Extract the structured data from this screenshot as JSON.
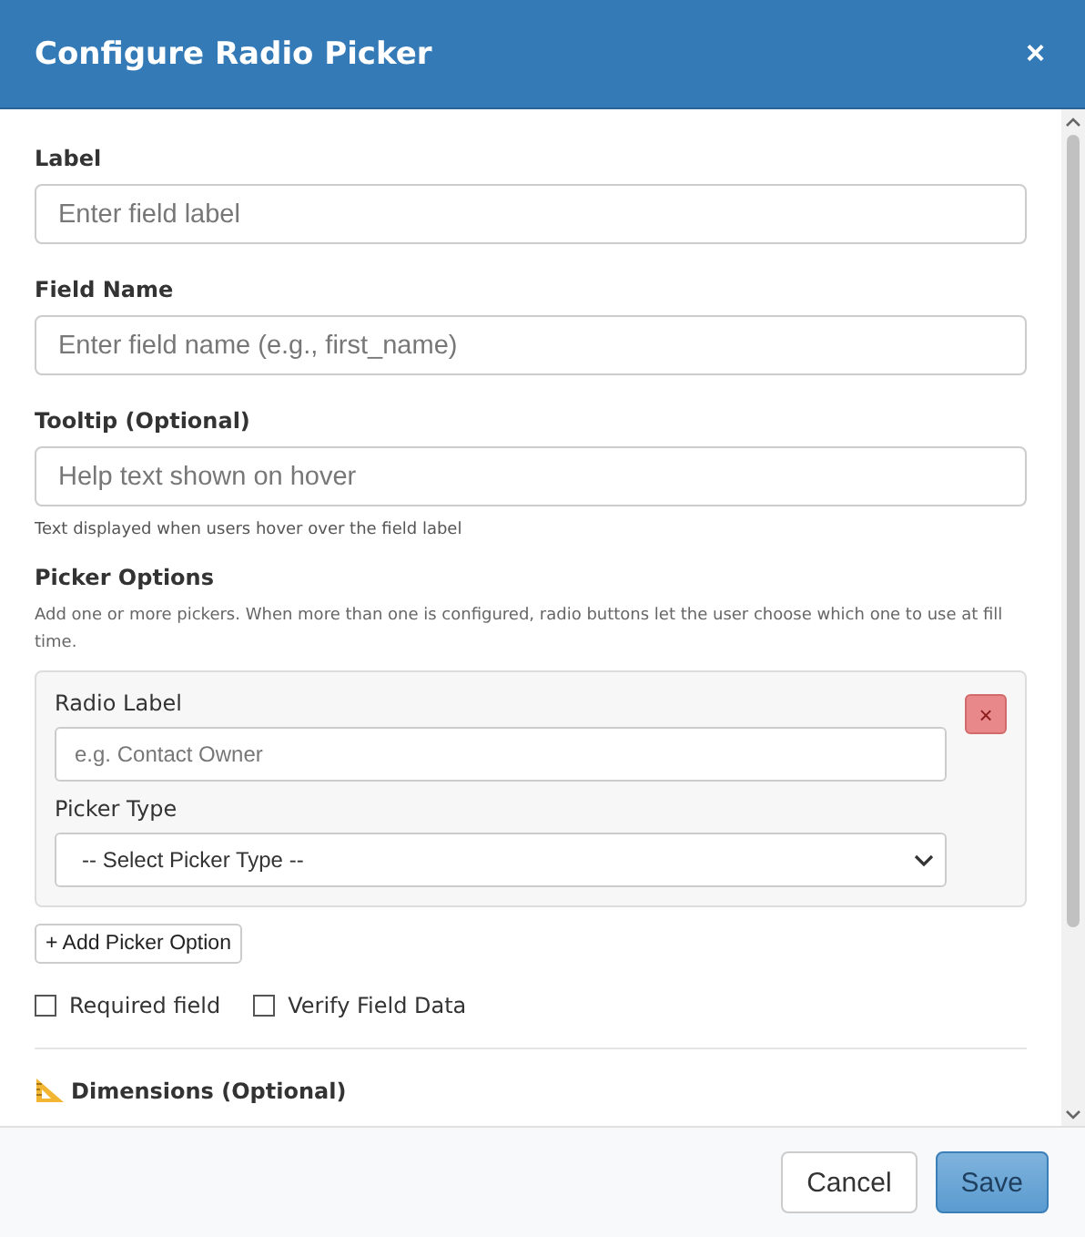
{
  "dialog": {
    "title": "Configure Radio Picker",
    "close": "×"
  },
  "fields": [
    {
      "label": "Label",
      "placeholder": "Enter field label"
    },
    {
      "label": "Field Name",
      "placeholder": "Enter field name (e.g., first_name)"
    },
    {
      "label": "Tooltip (Optional)",
      "placeholder": "Help text shown on hover",
      "help": "Text displayed when users hover over the field label"
    }
  ],
  "picker_options": {
    "heading": "Picker Options",
    "description": "Add one or more pickers. When more than one is configured, radio buttons let the user choose which one to use at fill time.",
    "options": [
      {
        "radio_label": "Radio Label",
        "radio_placeholder": "e.g. Contact Owner",
        "type_label": "Picker Type",
        "type_value": "-- Select Picker Type --",
        "remove": "×"
      }
    ],
    "add_button": "+ Add Picker Option"
  },
  "checkboxes": [
    {
      "label": "Required field",
      "checked": false
    },
    {
      "label": "Verify Field Data",
      "checked": false
    }
  ],
  "section": {
    "title": "Dimensions (Optional)"
  },
  "buttons": [
    {
      "label": "Cancel",
      "kind": "secondary"
    },
    {
      "label": "Save",
      "kind": "primary"
    }
  ]
}
